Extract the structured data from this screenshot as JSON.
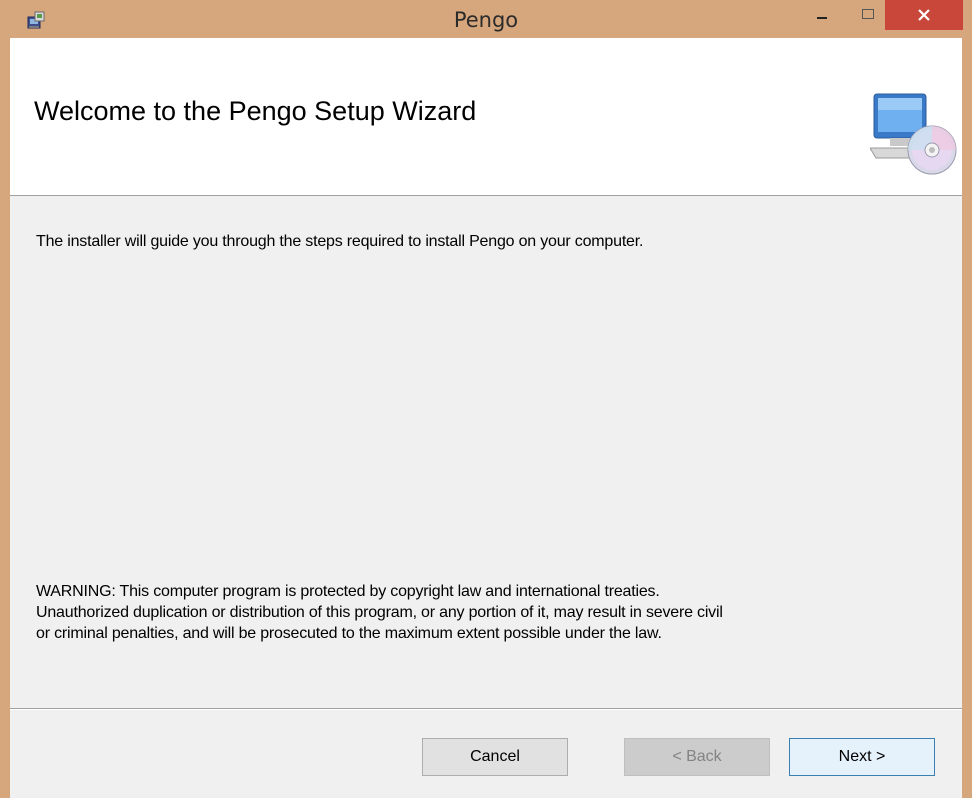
{
  "window": {
    "title": "Pengo",
    "controls": {
      "minimize": "−",
      "maximize": "☐",
      "close": "✕"
    }
  },
  "banner": {
    "title": "Welcome to the Pengo Setup Wizard",
    "icon": "computer-cd-icon"
  },
  "body": {
    "intro": "The installer will guide you through the steps required to install Pengo on your computer.",
    "warning_lines": [
      "WARNING: This computer program is protected by copyright law and international treaties.",
      "Unauthorized duplication or distribution of this program, or any portion of it, may result in severe civil",
      "or criminal penalties, and will be prosecuted to the maximum extent possible under the law."
    ]
  },
  "buttons": {
    "cancel": "Cancel",
    "back": "< Back",
    "next": "Next >"
  },
  "colors": {
    "titlebar": "#d6a67c",
    "close_button": "#c8463a",
    "client_bg": "#f0f0f0",
    "next_border": "#3c7fb1"
  }
}
